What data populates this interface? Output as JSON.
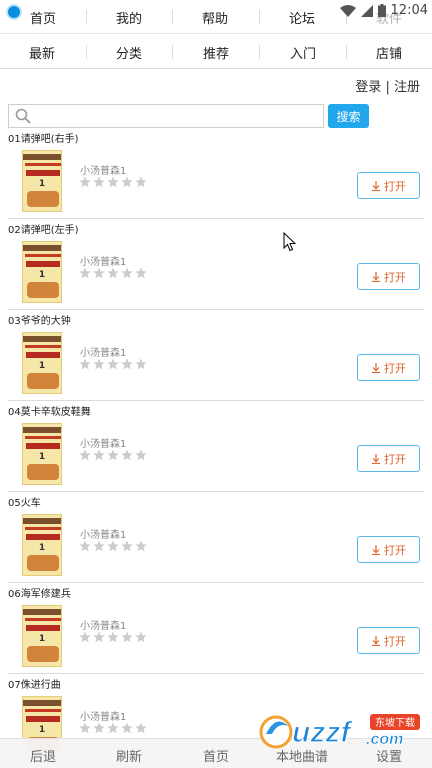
{
  "topnav": {
    "items": [
      "首页",
      "我的",
      "帮助",
      "论坛",
      "软件"
    ],
    "time": "12:04"
  },
  "categories": [
    "最新",
    "分类",
    "推荐",
    "入门",
    "店铺"
  ],
  "auth": {
    "login": "登录",
    "separator": "|",
    "register": "注册"
  },
  "search": {
    "placeholder": "",
    "button": "搜索"
  },
  "list": [
    {
      "title": "01请弹吧(右手)",
      "book": "小汤普森1",
      "rating": 0,
      "cover_number": "1",
      "action": "打开"
    },
    {
      "title": "02请弹吧(左手)",
      "book": "小汤普森1",
      "rating": 0,
      "cover_number": "1",
      "action": "打开"
    },
    {
      "title": "03爷爷的大钟",
      "book": "小汤普森1",
      "rating": 0,
      "cover_number": "1",
      "action": "打开"
    },
    {
      "title": "04莫卡辛软皮鞋舞",
      "book": "小汤普森1",
      "rating": 0,
      "cover_number": "1",
      "action": "打开"
    },
    {
      "title": "05火车",
      "book": "小汤普森1",
      "rating": 0,
      "cover_number": "1",
      "action": "打开"
    },
    {
      "title": "06海军修建兵",
      "book": "小汤普森1",
      "rating": 0,
      "cover_number": "1",
      "action": "打开"
    },
    {
      "title": "07侏进行曲",
      "book": "小汤普森1",
      "rating": 0,
      "cover_number": "1",
      "action": ""
    }
  ],
  "bottombar": [
    "后退",
    "刷新",
    "首页",
    "本地曲谱",
    "设置"
  ],
  "watermark": {
    "text": "uzzf",
    "domain": ".com",
    "tag": "东坡下载"
  },
  "colors": {
    "accent": "#22a7ec",
    "open_text": "#e0622a",
    "open_border": "#5bb8e8",
    "star_empty": "#cccccc"
  }
}
